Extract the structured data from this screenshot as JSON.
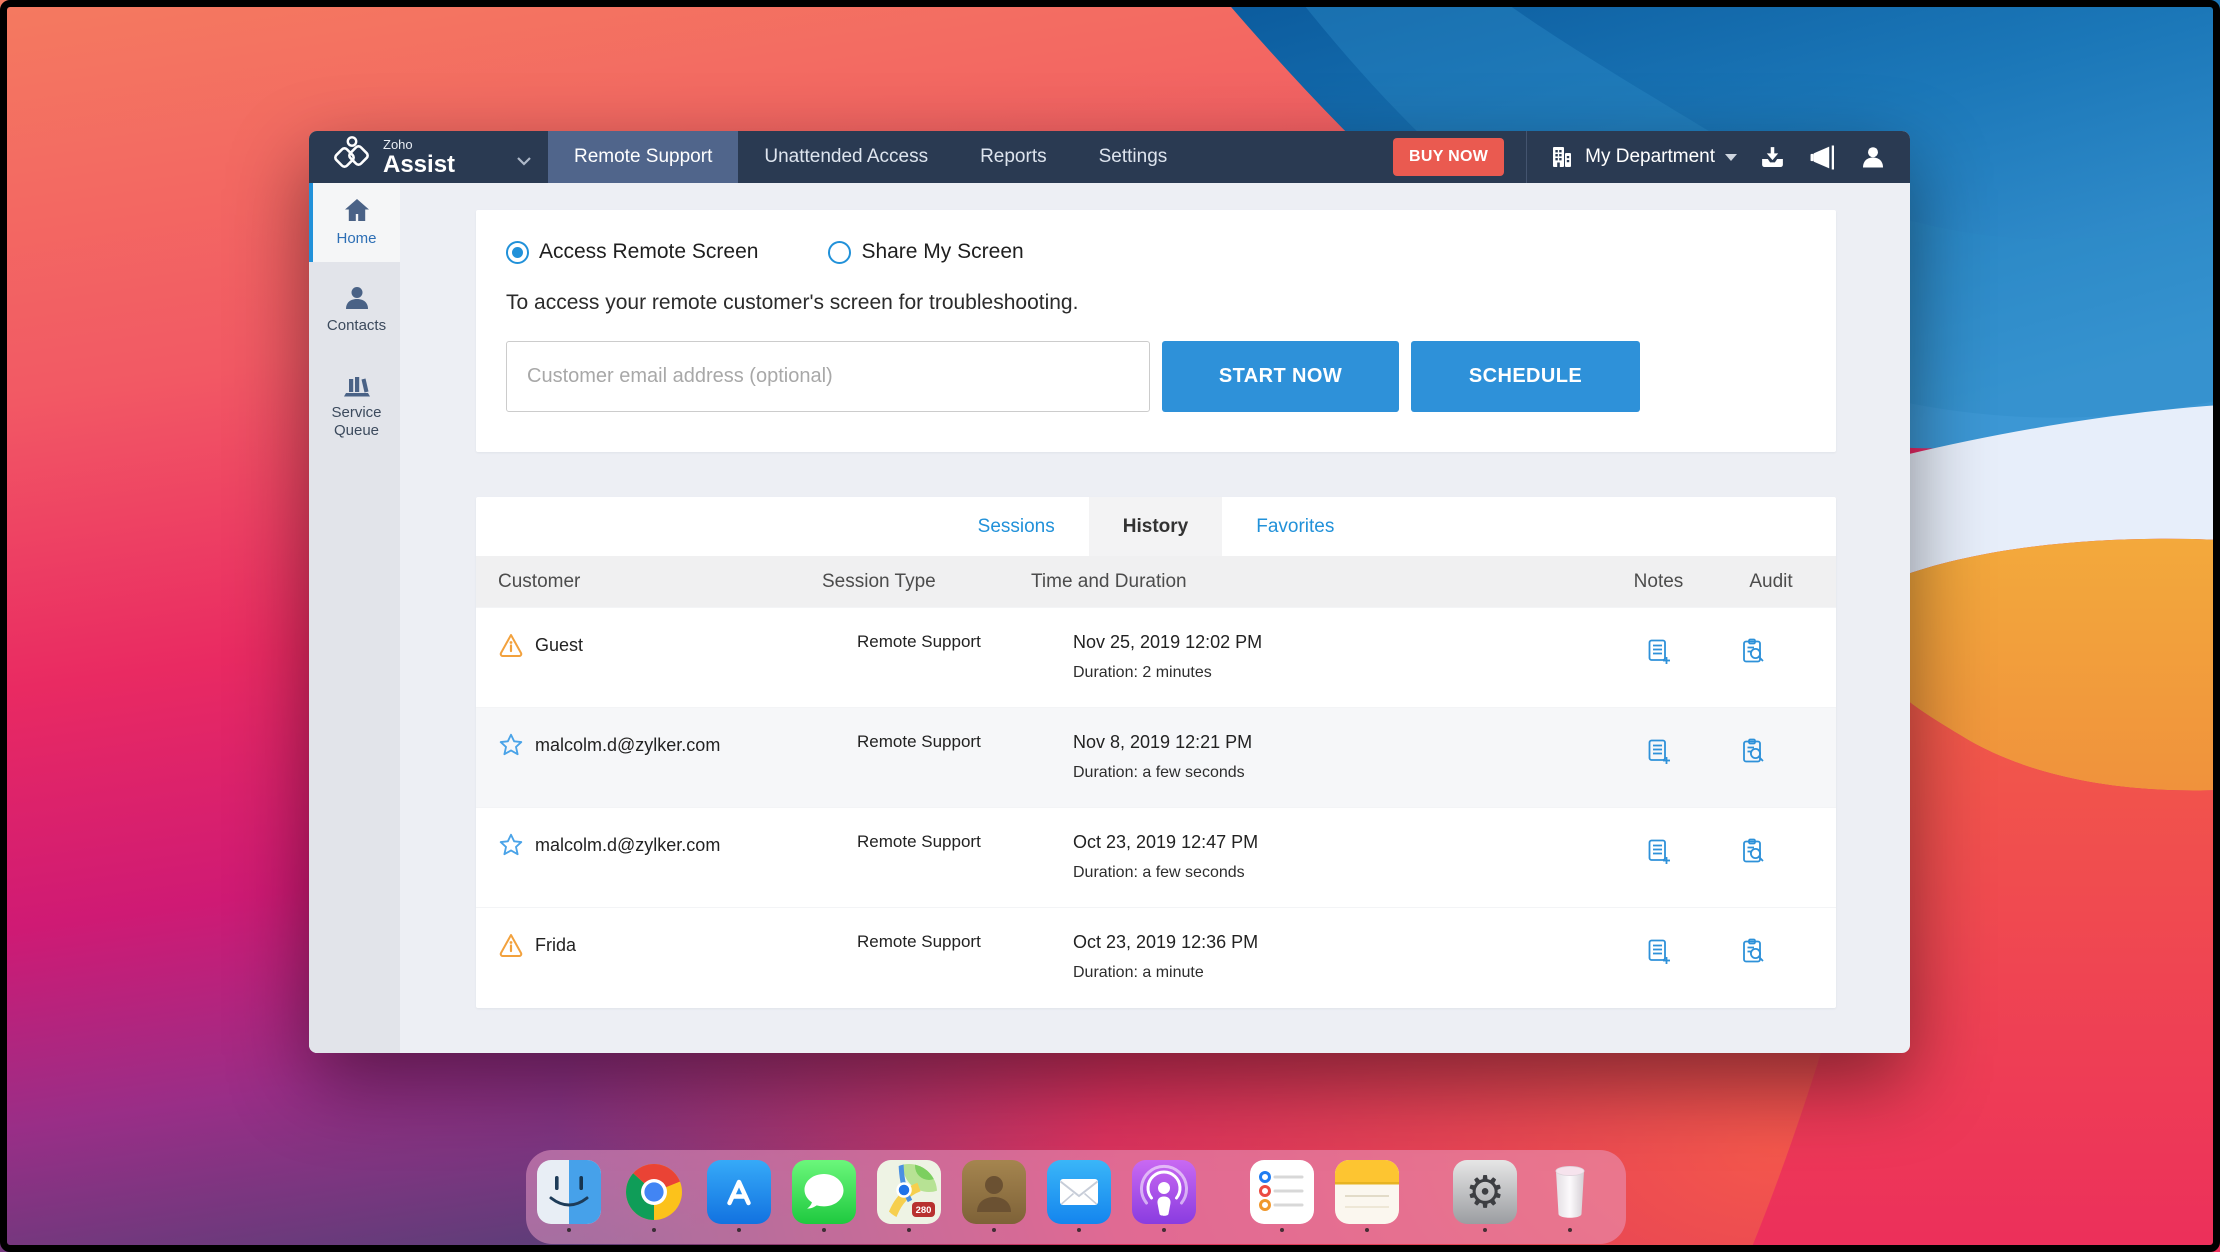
{
  "colors": {
    "nav_bg": "#2a3a52",
    "nav_active_tab": "#50658b",
    "accent_blue": "#2e91d9",
    "link_blue": "#2191d9",
    "buy_now_red": "#ea5a50",
    "warning_orange": "#f2a13d",
    "star_blue": "#4aa3e8"
  },
  "window": {
    "nav": {
      "brand_top": "Zoho",
      "brand_bottom": "Assist",
      "tabs": [
        {
          "label": "Remote Support",
          "active": true
        },
        {
          "label": "Unattended Access",
          "active": false
        },
        {
          "label": "Reports",
          "active": false
        },
        {
          "label": "Settings",
          "active": false
        }
      ],
      "buy_now_label": "BUY NOW",
      "department_label": "My Department"
    },
    "sidebar": {
      "items": [
        {
          "label": "Home",
          "icon": "home-icon",
          "active": true
        },
        {
          "label": "Contacts",
          "icon": "contacts-icon",
          "active": false
        },
        {
          "label": "Service Queue",
          "icon": "service-queue-icon",
          "active": false
        }
      ]
    },
    "session_panel": {
      "radio_access_label": "Access Remote Screen",
      "radio_share_label": "Share My Screen",
      "access_selected": true,
      "description": "To access your remote customer's screen for troubleshooting.",
      "email_placeholder": "Customer email address (optional)",
      "start_button": "START NOW",
      "schedule_button": "SCHEDULE"
    },
    "history_panel": {
      "tabs": [
        {
          "label": "Sessions",
          "active": false
        },
        {
          "label": "History",
          "active": true
        },
        {
          "label": "Favorites",
          "active": false
        }
      ],
      "columns": [
        "Customer",
        "Session Type",
        "Time and Duration",
        "Notes",
        "Audit"
      ],
      "rows": [
        {
          "icon": "warning-icon",
          "customer": "Guest",
          "session_type": "Remote Support",
          "time": "Nov 25, 2019 12:02 PM",
          "duration": "Duration: 2 minutes"
        },
        {
          "icon": "star-icon",
          "customer": "malcolm.d@zylker.com",
          "session_type": "Remote Support",
          "time": "Nov 8, 2019 12:21 PM",
          "duration": "Duration: a few seconds"
        },
        {
          "icon": "star-icon",
          "customer": "malcolm.d@zylker.com",
          "session_type": "Remote Support",
          "time": "Oct 23, 2019 12:47 PM",
          "duration": "Duration: a few seconds"
        },
        {
          "icon": "warning-icon",
          "customer": "Frida",
          "session_type": "Remote Support",
          "time": "Oct 23, 2019 12:36 PM",
          "duration": "Duration: a minute"
        }
      ]
    }
  },
  "dock": {
    "apps": [
      "finder",
      "chrome",
      "app-store",
      "messages",
      "maps",
      "contacts",
      "mail",
      "podcasts",
      "reminders",
      "notes",
      "system-preferences",
      "trash"
    ],
    "maps_badge": "280"
  }
}
